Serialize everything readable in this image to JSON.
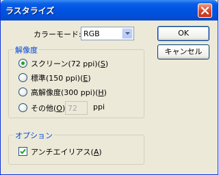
{
  "window": {
    "title": "ラスタライズ"
  },
  "color_mode": {
    "label": "カラーモード:",
    "value": "RGB"
  },
  "buttons": {
    "ok": "OK",
    "cancel": "キャンセル"
  },
  "resolution": {
    "group_label": "解像度",
    "options": [
      {
        "label": "スクリーン(72 ppi)(",
        "key": "S",
        "end": ")",
        "checked": true
      },
      {
        "label": "標準(150 ppi)(",
        "key": "E",
        "end": ")",
        "checked": false
      },
      {
        "label": "高解像度(300 ppi)(",
        "key": "H",
        "end": ")",
        "checked": false
      },
      {
        "label": "その他(",
        "key": "O",
        "end": "):",
        "checked": false
      }
    ],
    "other_value": "72",
    "other_unit": "ppi"
  },
  "options": {
    "group_label": "オプション",
    "antialias": {
      "label": "アンチエイリアス(",
      "key": "A",
      "end": ")",
      "checked": true
    }
  }
}
